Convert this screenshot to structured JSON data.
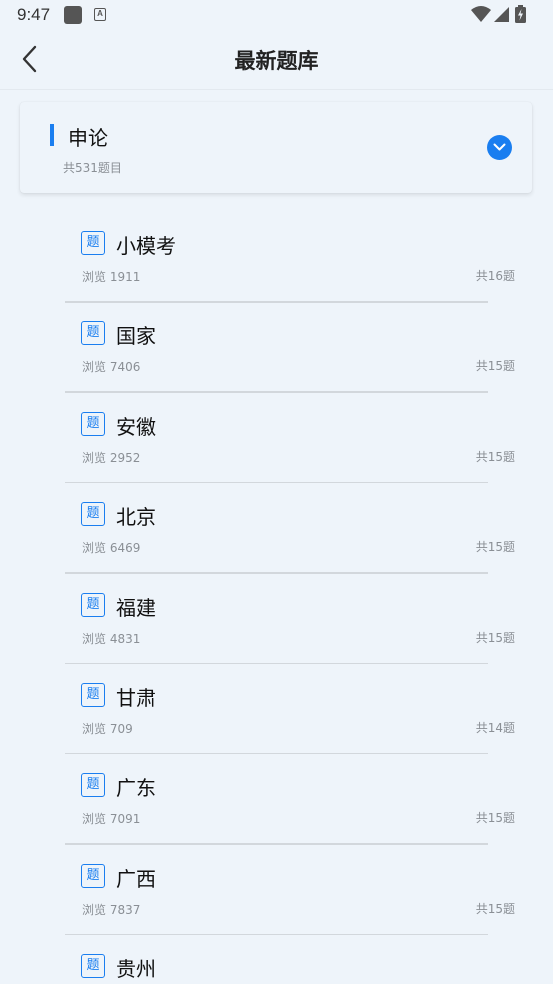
{
  "status_bar": {
    "time": "9:47",
    "icons": [
      "app-square-icon",
      "a-box-icon",
      "wifi-icon",
      "signal-icon",
      "battery-charging-icon"
    ]
  },
  "header": {
    "title": "最新题库",
    "back_icon": "chevron-left-icon"
  },
  "category": {
    "name": "申论",
    "count": "共531题目",
    "toggle_icon": "chevron-down-circle-icon",
    "accent_color": "#1a7ef0"
  },
  "items": [
    {
      "tag": "题",
      "title": "小模考",
      "views": "浏览 1911",
      "total": "共16题"
    },
    {
      "tag": "题",
      "title": "国家",
      "views": "浏览 7406",
      "total": "共15题"
    },
    {
      "tag": "题",
      "title": "安徽",
      "views": "浏览 2952",
      "total": "共15题"
    },
    {
      "tag": "题",
      "title": "北京",
      "views": "浏览 6469",
      "total": "共15题"
    },
    {
      "tag": "题",
      "title": "福建",
      "views": "浏览 4831",
      "total": "共15题"
    },
    {
      "tag": "题",
      "title": "甘肃",
      "views": "浏览 709",
      "total": "共14题"
    },
    {
      "tag": "题",
      "title": "广东",
      "views": "浏览 7091",
      "total": "共15题"
    },
    {
      "tag": "题",
      "title": "广西",
      "views": "浏览 7837",
      "total": "共15题"
    },
    {
      "tag": "题",
      "title": "贵州",
      "views": "",
      "total": ""
    }
  ]
}
